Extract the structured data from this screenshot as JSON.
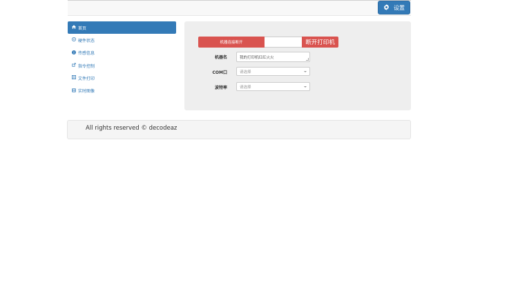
{
  "header": {
    "settings_label": "设置"
  },
  "sidebar": {
    "items": [
      {
        "label": "首页",
        "icon": "home-icon",
        "active": true
      },
      {
        "label": "硬件状态",
        "icon": "circle-arrow-icon",
        "active": false
      },
      {
        "label": "传感信息",
        "icon": "info-circle-icon",
        "active": false
      },
      {
        "label": "指令控制",
        "icon": "share-square-icon",
        "active": false
      },
      {
        "label": "文件打印",
        "icon": "list-alt-icon",
        "active": false
      },
      {
        "label": "实时图像",
        "icon": "film-icon",
        "active": false
      }
    ]
  },
  "status": {
    "label": "机器连接断开",
    "disconnect_button": "断开打印机"
  },
  "form": {
    "name_label": "机器名",
    "name_value": "我的打印机红红火火",
    "com_label": "COM口",
    "com_placeholder": "请选择",
    "baud_label": "波特率",
    "baud_placeholder": "请选择"
  },
  "footer": {
    "text": "All rights reserved © decodeaz"
  },
  "colors": {
    "primary": "#337ab7",
    "danger": "#d9534f",
    "panel": "#eeeeee"
  }
}
